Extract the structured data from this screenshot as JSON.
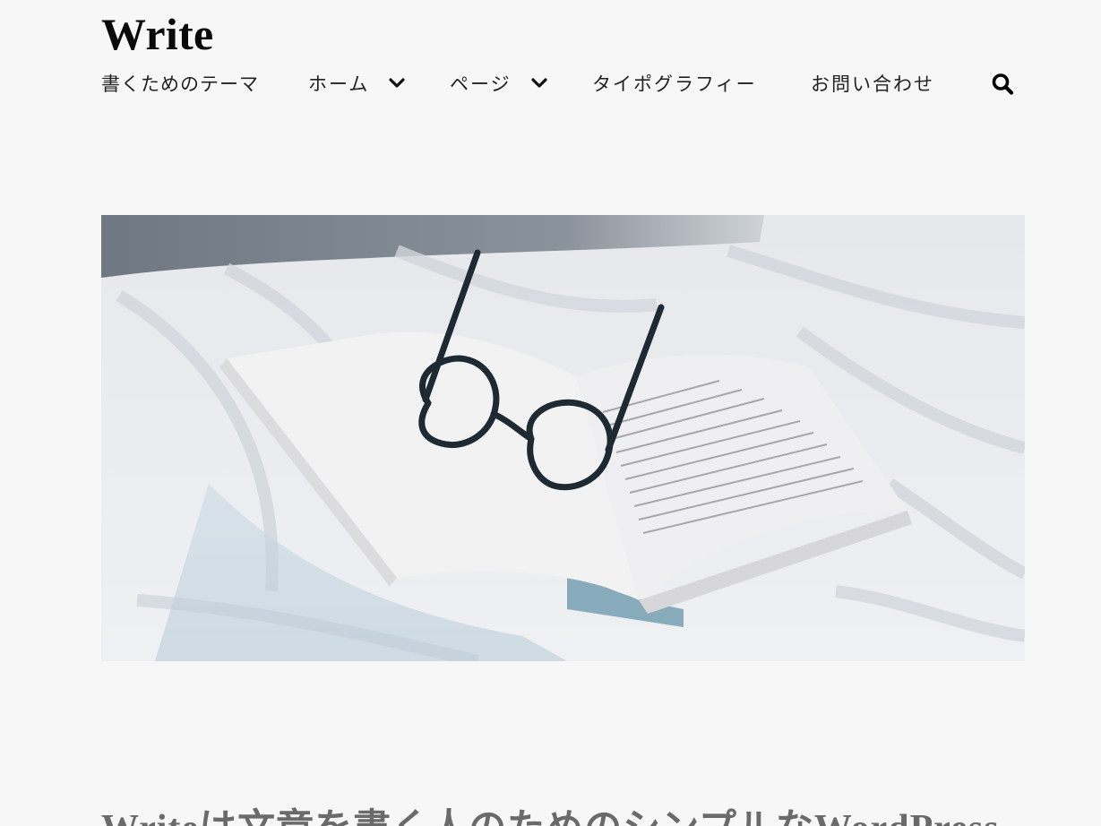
{
  "site": {
    "title": "Write",
    "tagline": "書くためのテーマ"
  },
  "nav": {
    "items": [
      {
        "label": "ホーム",
        "has_submenu": true
      },
      {
        "label": "ページ",
        "has_submenu": true
      },
      {
        "label": "タイポグラフィー",
        "has_submenu": false
      },
      {
        "label": "お問い合わせ",
        "has_submenu": false
      }
    ],
    "search_icon": "search-icon"
  },
  "hero": {
    "image": "open-book-with-glasses-on-bedsheet"
  },
  "post": {
    "title": "Writeは文章を書く人のためのシンプルなWordPress"
  },
  "colors": {
    "background": "#f7f7f7",
    "text": "#111111",
    "post_title": "#6a6a6a"
  }
}
